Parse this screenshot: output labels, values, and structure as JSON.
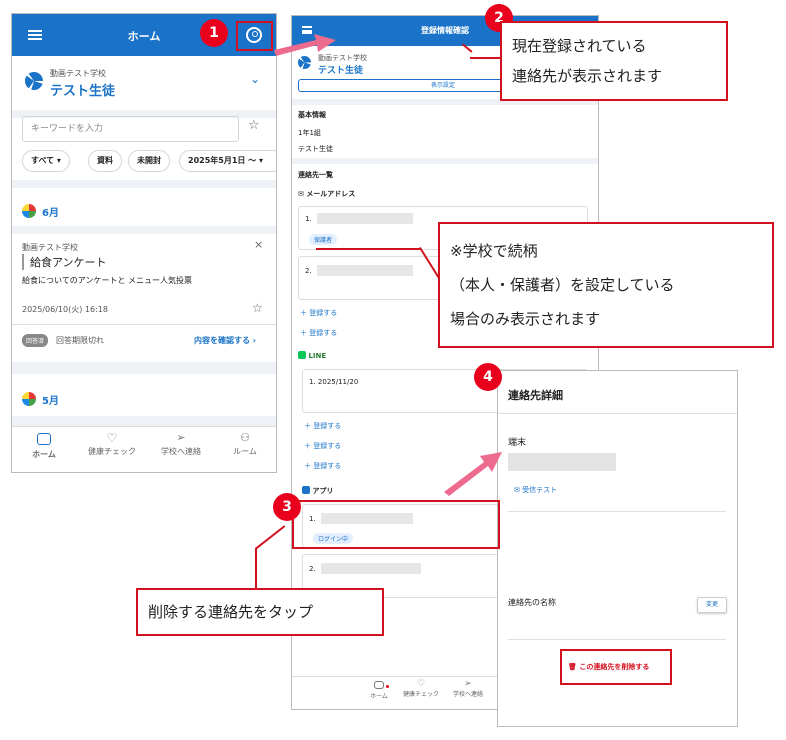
{
  "screen1": {
    "header_title": "ホーム",
    "school_name": "動画テスト学校",
    "student_name": "テスト生徒",
    "search_placeholder": "キーワードを入力",
    "filter_chips": [
      "すべて",
      "資料",
      "未開封",
      "2025年5月1日 ～"
    ],
    "month1": "6月",
    "item": {
      "school": "動画テスト学校",
      "title": "給食アンケート",
      "desc": "給食についてのアンケートと メニュー人気投票",
      "datetime": "2025/06/10(火) 16:18",
      "status_badge": "回答済",
      "status_text": "回答期限切れ",
      "confirm_link": "内容を確認する"
    },
    "month2": "5月",
    "tabs": [
      {
        "label": "ホーム",
        "icon": "inbox-icon"
      },
      {
        "label": "健康チェック",
        "icon": "heart-icon"
      },
      {
        "label": "学校へ連絡",
        "icon": "send-icon"
      },
      {
        "label": "ルーム",
        "icon": "people-icon"
      }
    ]
  },
  "screen2": {
    "header_title": "登録情報確認",
    "school_name": "動画テスト学校",
    "student_name": "テスト生徒",
    "display_settings_button": "表示設定",
    "basic_info_heading": "基本情報",
    "grade": "1年1組",
    "student": "テスト生徒",
    "contacts_heading": "連絡先一覧",
    "email_section": "メールアドレス",
    "email_items": [
      {
        "num": "1.",
        "badge": "保護者"
      },
      {
        "num": "2."
      }
    ],
    "add_label": "登録する",
    "line_section": "LINE",
    "line_item": {
      "num": "1.",
      "date": "2025/11/20"
    },
    "app_section": "アプリ",
    "app_items": [
      {
        "num": "1.",
        "badge": "ログイン中"
      },
      {
        "num": "2."
      }
    ],
    "tabs": [
      {
        "label": "ホーム"
      },
      {
        "label": "健康チェック"
      },
      {
        "label": "学校へ連絡"
      }
    ]
  },
  "screen3": {
    "title": "連絡先詳細",
    "device_label": "端末",
    "receive_test": "受信テスト",
    "contact_name_label": "連絡先の名称",
    "change_button": "変更",
    "delete_button": "この連絡先を削除する"
  },
  "annotations": {
    "step1": "1",
    "step2": "2",
    "step3": "3",
    "step4": "4",
    "callout2_line1": "現在登録されている",
    "callout2_line2": "連絡先が表示されます",
    "callout_relation_line1": "※学校で続柄",
    "callout_relation_line2": "（本人・保護者）を設定している",
    "callout_relation_line3": "場合のみ表示されます",
    "callout3": "削除する連絡先をタップ"
  },
  "colors": {
    "primary": "#1a73c8",
    "annotation_red": "#d3101e"
  }
}
